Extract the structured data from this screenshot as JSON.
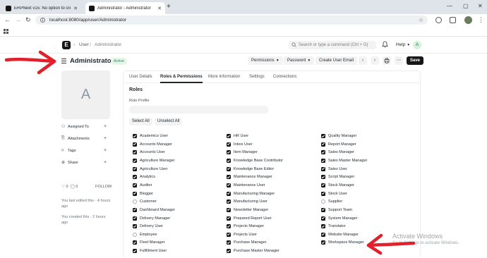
{
  "browser": {
    "tabs": [
      {
        "title": "ERPNext v15: No option to cre"
      },
      {
        "title": "Administrator - Administrator"
      }
    ],
    "url": "localhost:8080/app/user/Administrator"
  },
  "app": {
    "logo": "E",
    "breadcrumbs": [
      "User",
      "Administrator"
    ],
    "search_placeholder": "Search or type a command (Ctrl + G)",
    "help_label": "Help",
    "user_initial": "A"
  },
  "page": {
    "title": "Administrator",
    "status": "Active",
    "buttons": {
      "permissions": "Permissions",
      "password": "Password",
      "reset": "Create User Email",
      "save": "Save"
    }
  },
  "sidebar": {
    "avatar_initial": "A",
    "items": [
      {
        "label": "Assigned To",
        "icon": "person-plus-icon"
      },
      {
        "label": "Attachments",
        "icon": "paperclip-icon"
      },
      {
        "label": "Tags",
        "icon": "tag-icon"
      },
      {
        "label": "Share",
        "icon": "share-icon"
      }
    ],
    "likes": "0",
    "comments": "0",
    "follow": "FOLLOW",
    "last_edited": "You last edited this · 4 hours ago",
    "created": "You created this · 2 hours ago"
  },
  "form": {
    "tabs": [
      "User Details",
      "Roles & Permissions",
      "More Information",
      "Settings",
      "Connections"
    ],
    "active_tab": "Roles & Permissions",
    "section_title": "Roles",
    "role_profile_label": "Role Profile",
    "select_all": "Select All",
    "unselect_all": "Unselect All",
    "roles": [
      [
        {
          "name": "Academics User",
          "checked": true
        },
        {
          "name": "Accounts Manager",
          "checked": true
        },
        {
          "name": "Accounts User",
          "checked": true
        },
        {
          "name": "Agriculture Manager",
          "checked": true
        },
        {
          "name": "Agriculture User",
          "checked": true
        },
        {
          "name": "Analytics",
          "checked": true
        },
        {
          "name": "Auditor",
          "checked": true
        },
        {
          "name": "Blogger",
          "checked": true
        },
        {
          "name": "Customer",
          "checked": false
        },
        {
          "name": "Dashboard Manager",
          "checked": true
        },
        {
          "name": "Delivery Manager",
          "checked": true
        },
        {
          "name": "Delivery User",
          "checked": true
        },
        {
          "name": "Employee",
          "checked": false
        },
        {
          "name": "Fleet Manager",
          "checked": true
        },
        {
          "name": "Fulfillment User",
          "checked": true
        }
      ],
      [
        {
          "name": "HR User",
          "checked": true
        },
        {
          "name": "Inbox User",
          "checked": true
        },
        {
          "name": "Item Manager",
          "checked": true
        },
        {
          "name": "Knowledge Base Contributor",
          "checked": true
        },
        {
          "name": "Knowledge Base Editor",
          "checked": true
        },
        {
          "name": "Maintenance Manager",
          "checked": true
        },
        {
          "name": "Maintenance User",
          "checked": true
        },
        {
          "name": "Manufacturing Manager",
          "checked": true
        },
        {
          "name": "Manufacturing User",
          "checked": true
        },
        {
          "name": "Newsletter Manager",
          "checked": true
        },
        {
          "name": "Prepared Report User",
          "checked": true
        },
        {
          "name": "Projects Manager",
          "checked": true
        },
        {
          "name": "Projects User",
          "checked": true
        },
        {
          "name": "Purchase Manager",
          "checked": true
        },
        {
          "name": "Purchase Master Manager",
          "checked": true
        }
      ],
      [
        {
          "name": "Quality Manager",
          "checked": true
        },
        {
          "name": "Report Manager",
          "checked": true
        },
        {
          "name": "Sales Manager",
          "checked": true
        },
        {
          "name": "Sales Master Manager",
          "checked": true
        },
        {
          "name": "Sales User",
          "checked": true
        },
        {
          "name": "Script Manager",
          "checked": true
        },
        {
          "name": "Stock Manager",
          "checked": true
        },
        {
          "name": "Stock User",
          "checked": true
        },
        {
          "name": "Supplier",
          "checked": false
        },
        {
          "name": "Support Team",
          "checked": true
        },
        {
          "name": "System Manager",
          "checked": true
        },
        {
          "name": "Translator",
          "checked": true
        },
        {
          "name": "Website Manager",
          "checked": true
        },
        {
          "name": "Workspace Manager",
          "checked": true
        }
      ]
    ]
  },
  "watermark": {
    "title": "Activate Windows",
    "subtitle": "Go to Settings to activate Windows."
  },
  "colors": {
    "primary": "#171717",
    "active_badge_bg": "#e4f5e9",
    "active_badge_text": "#278f5e",
    "annotation": "#e0202a"
  }
}
